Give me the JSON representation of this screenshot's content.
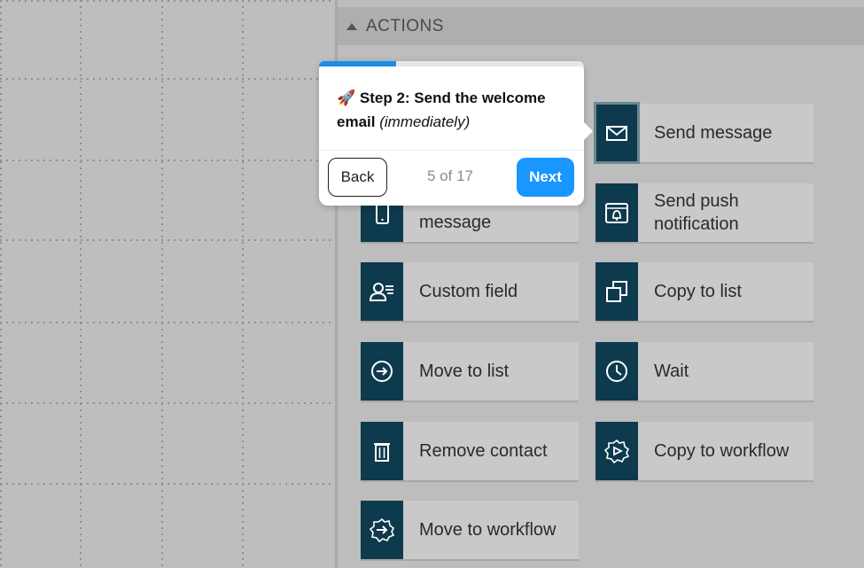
{
  "panel": {
    "title": "ACTIONS"
  },
  "actions": [
    {
      "label": "Send message",
      "icon": "envelope-icon"
    },
    {
      "label": "Send push notification",
      "icon": "push-notification-icon"
    },
    {
      "label": "message",
      "icon": "mobile-message-icon"
    },
    {
      "label": "Custom field",
      "icon": "contact-card-icon"
    },
    {
      "label": "Copy to list",
      "icon": "copy-icon"
    },
    {
      "label": "Move to list",
      "icon": "arrow-circle-icon"
    },
    {
      "label": "Wait",
      "icon": "clock-icon"
    },
    {
      "label": "Remove contact",
      "icon": "trash-icon"
    },
    {
      "label": "Copy to workflow",
      "icon": "gear-play-icon"
    },
    {
      "label": "Move to workflow",
      "icon": "gear-arrow-icon"
    }
  ],
  "tour": {
    "emoji": "🚀",
    "step_title": "Step 2: Send the welcome",
    "step_line2": "email",
    "step_note": "(immediately)",
    "back_label": "Back",
    "next_label": "Next",
    "counter": "5 of 17",
    "progress": 0.29,
    "accent_color": "#1a96ff"
  },
  "colors": {
    "icon_bg": "#0e3a4d",
    "tile_bg": "#c9c9c9"
  }
}
